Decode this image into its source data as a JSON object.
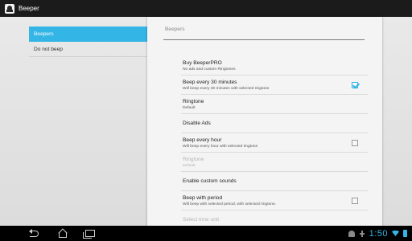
{
  "action_bar": {
    "title": "Beeper",
    "app_icon": "beeper-app-icon"
  },
  "headers": [
    {
      "label": "Beepers",
      "active": true
    },
    {
      "label": "Do not beep",
      "active": false
    }
  ],
  "panel": {
    "breadcrumb": "Beepers",
    "preferences": [
      {
        "title": "Buy BeeperPRO",
        "summary": "No ads and custom Ringtones",
        "checkbox": null,
        "enabled": true
      },
      {
        "title": "Beep every 30 minutes",
        "summary": "Will beep every 30 minutes with selected ringtone",
        "checkbox": true,
        "enabled": true
      },
      {
        "title": "Ringtone",
        "summary": "Default",
        "checkbox": null,
        "enabled": true
      },
      {
        "title": "Disable Ads",
        "summary": "",
        "checkbox": null,
        "enabled": true
      },
      {
        "title": "Beep every hour",
        "summary": "Will beep every hour with selected ringtone",
        "checkbox": false,
        "enabled": true
      },
      {
        "title": "Ringtone",
        "summary": "Default",
        "checkbox": null,
        "enabled": false
      },
      {
        "title": "Enable custom sounds",
        "summary": "",
        "checkbox": null,
        "enabled": true
      },
      {
        "title": "Beep with period",
        "summary": "Will beep with selected period, with selected ringtone.",
        "checkbox": false,
        "enabled": true
      },
      {
        "title": "Select time unit",
        "summary": "",
        "checkbox": null,
        "enabled": false
      }
    ]
  },
  "status_bar": {
    "clock": "1:50",
    "icons": [
      "android-icon",
      "usb-icon",
      "wifi-icon",
      "battery-icon"
    ]
  },
  "nav_bar": {
    "buttons": [
      "back-icon",
      "home-icon",
      "recents-icon"
    ]
  },
  "colors": {
    "accent": "#33b5e5",
    "action_bar": "#1b1b1b",
    "nav_bar": "#000000"
  }
}
